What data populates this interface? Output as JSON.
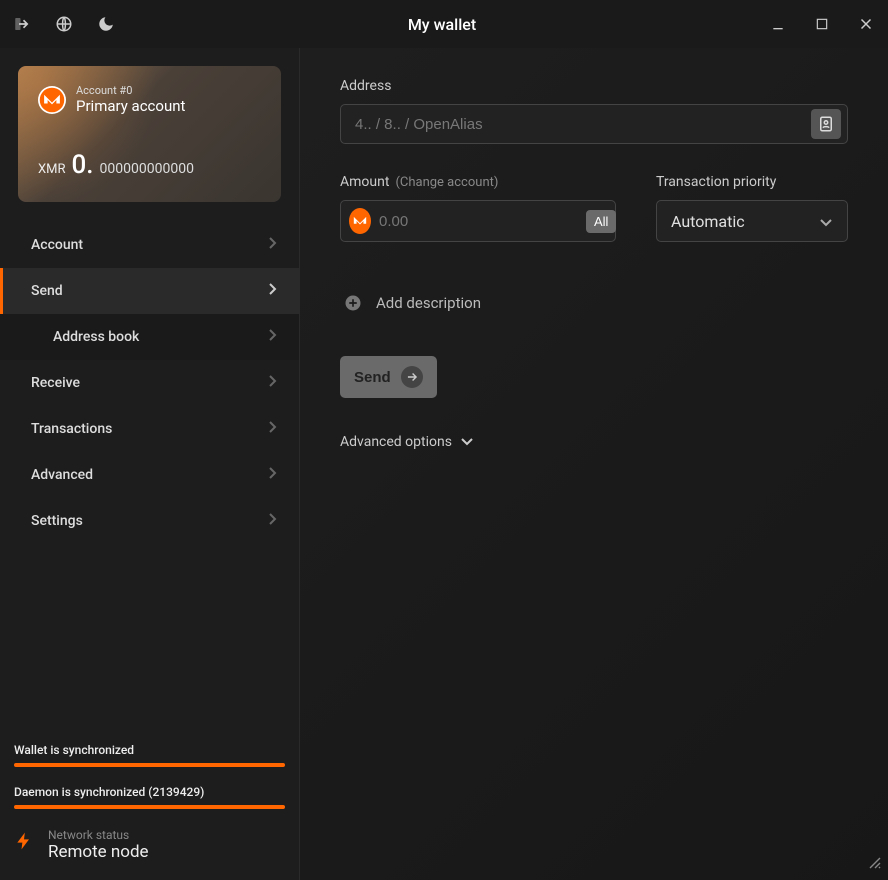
{
  "titlebar": {
    "title": "My wallet"
  },
  "account": {
    "number": "Account #0",
    "name": "Primary account",
    "currency": "XMR",
    "balance_int": "0.",
    "balance_dec": "000000000000"
  },
  "nav": {
    "account": "Account",
    "send": "Send",
    "address_book": "Address book",
    "receive": "Receive",
    "transactions": "Transactions",
    "advanced": "Advanced",
    "settings": "Settings"
  },
  "sync": {
    "wallet": "Wallet is synchronized",
    "daemon": "Daemon is synchronized (2139429)"
  },
  "network": {
    "label": "Network status",
    "value": "Remote node"
  },
  "form": {
    "address_label": "Address",
    "address_placeholder": "4.. / 8.. / OpenAlias",
    "amount_label": "Amount",
    "change_account": "(Change account)",
    "amount_placeholder": "0.00",
    "all_btn": "All",
    "priority_label": "Transaction priority",
    "priority_value": "Automatic",
    "add_description": "Add description",
    "send_btn": "Send",
    "advanced_options": "Advanced options"
  }
}
